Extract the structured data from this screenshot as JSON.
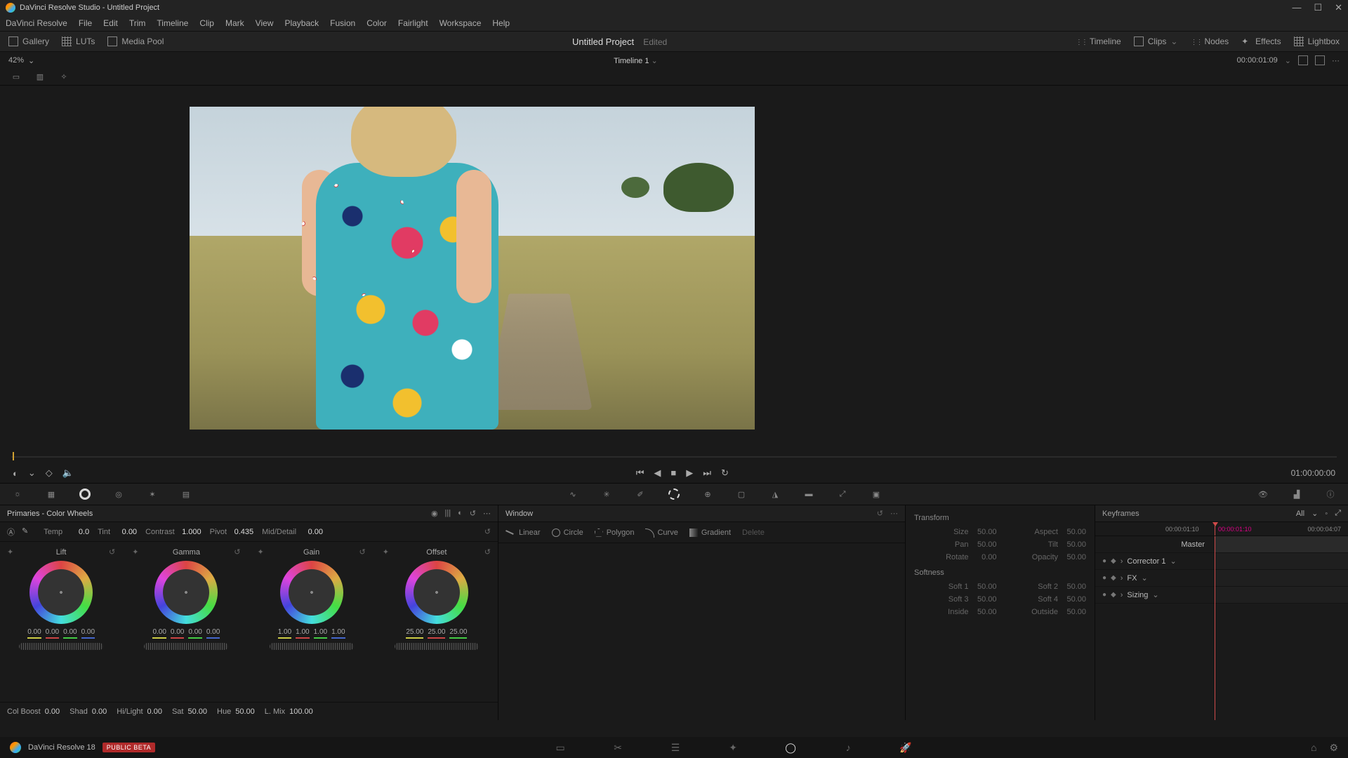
{
  "titleBar": {
    "title": "DaVinci Resolve Studio - Untitled Project"
  },
  "menu": [
    "DaVinci Resolve",
    "File",
    "Edit",
    "Trim",
    "Timeline",
    "Clip",
    "Mark",
    "View",
    "Playback",
    "Fusion",
    "Color",
    "Fairlight",
    "Workspace",
    "Help"
  ],
  "topToolbar": {
    "left": [
      {
        "name": "gallery",
        "label": "Gallery"
      },
      {
        "name": "luts",
        "label": "LUTs"
      },
      {
        "name": "mediapool",
        "label": "Media Pool"
      }
    ],
    "project": "Untitled Project",
    "edited": "Edited",
    "right": [
      {
        "name": "timeline",
        "label": "Timeline"
      },
      {
        "name": "clips",
        "label": "Clips"
      },
      {
        "name": "nodes",
        "label": "Nodes"
      },
      {
        "name": "effects",
        "label": "Effects"
      },
      {
        "name": "lightbox",
        "label": "Lightbox"
      }
    ]
  },
  "zoomBar": {
    "zoom": "42%",
    "timelineName": "Timeline 1",
    "timecode": "00:00:01:09"
  },
  "transport": {
    "timecode": "01:00:00:00"
  },
  "toolStrip": {
    "leftTools": [
      "camera-raw",
      "color-match",
      "color-wheels",
      "hdr-wheels",
      "rgb-mixer",
      "motion-effects"
    ],
    "centerTools": [
      "curves",
      "color-warper",
      "qualifier",
      "window",
      "tracker",
      "magic-mask",
      "bsm",
      "key",
      "sizing",
      "3d"
    ],
    "rightTools": [
      "waveform",
      "histogram",
      "info"
    ]
  },
  "primaries": {
    "title": "Primaries - Color Wheels",
    "params": {
      "temp": {
        "label": "Temp",
        "value": "0.0"
      },
      "tint": {
        "label": "Tint",
        "value": "0.00"
      },
      "contrast": {
        "label": "Contrast",
        "value": "1.000"
      },
      "pivot": {
        "label": "Pivot",
        "value": "0.435"
      },
      "middetail": {
        "label": "Mid/Detail",
        "value": "0.00"
      }
    },
    "wheels": [
      {
        "name": "Lift",
        "nums": [
          "0.00",
          "0.00",
          "0.00",
          "0.00"
        ]
      },
      {
        "name": "Gamma",
        "nums": [
          "0.00",
          "0.00",
          "0.00",
          "0.00"
        ]
      },
      {
        "name": "Gain",
        "nums": [
          "1.00",
          "1.00",
          "1.00",
          "1.00"
        ]
      },
      {
        "name": "Offset",
        "nums": [
          "25.00",
          "25.00",
          "25.00"
        ]
      }
    ],
    "bottom": {
      "colboost": {
        "label": "Col Boost",
        "value": "0.00"
      },
      "shad": {
        "label": "Shad",
        "value": "0.00"
      },
      "hilight": {
        "label": "Hi/Light",
        "value": "0.00"
      },
      "sat": {
        "label": "Sat",
        "value": "50.00"
      },
      "hue": {
        "label": "Hue",
        "value": "50.00"
      },
      "lmix": {
        "label": "L. Mix",
        "value": "100.00"
      }
    }
  },
  "windowPanel": {
    "title": "Window",
    "tabs": [
      {
        "name": "linear",
        "label": "Linear"
      },
      {
        "name": "circle",
        "label": "Circle"
      },
      {
        "name": "polygon",
        "label": "Polygon"
      },
      {
        "name": "curve",
        "label": "Curve"
      },
      {
        "name": "gradient",
        "label": "Gradient"
      },
      {
        "name": "delete",
        "label": "Delete"
      }
    ]
  },
  "transform": {
    "title1": "Transform",
    "fields1": [
      {
        "label": "Size",
        "value": "50.00"
      },
      {
        "label": "Aspect",
        "value": "50.00"
      },
      {
        "label": "Pan",
        "value": "50.00"
      },
      {
        "label": "Tilt",
        "value": "50.00"
      },
      {
        "label": "Rotate",
        "value": "0.00"
      },
      {
        "label": "Opacity",
        "value": "50.00"
      }
    ],
    "title2": "Softness",
    "fields2": [
      {
        "label": "Soft 1",
        "value": "50.00"
      },
      {
        "label": "Soft 2",
        "value": "50.00"
      },
      {
        "label": "Soft 3",
        "value": "50.00"
      },
      {
        "label": "Soft 4",
        "value": "50.00"
      },
      {
        "label": "Inside",
        "value": "50.00"
      },
      {
        "label": "Outside",
        "value": "50.00"
      }
    ]
  },
  "keyframes": {
    "title": "Keyframes",
    "mode": "All",
    "timecodes": {
      "start": "00:00:01:10",
      "cursor": "00:00:01:10",
      "end": "00:00:04:07"
    },
    "tracks": [
      {
        "name": "Master",
        "master": true
      },
      {
        "name": "Corrector 1"
      },
      {
        "name": "FX"
      },
      {
        "name": "Sizing"
      }
    ]
  },
  "pageBar": {
    "appName": "DaVinci Resolve 18",
    "badge": "PUBLIC BETA",
    "pages": [
      "media",
      "cut",
      "edit",
      "fusion",
      "color",
      "fairlight",
      "deliver"
    ]
  }
}
